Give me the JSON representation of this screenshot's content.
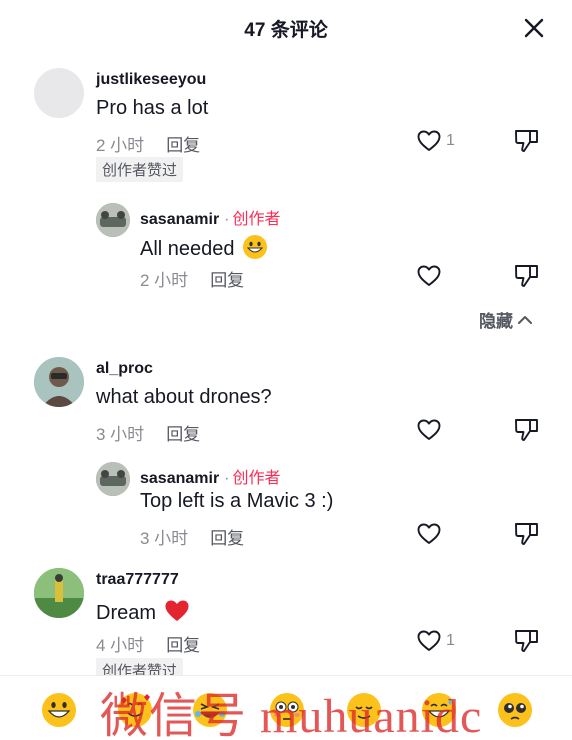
{
  "header": {
    "title": "47 条评论",
    "close_icon": "close-icon"
  },
  "comments": [
    {
      "username": "justlikeseeyou",
      "text": "Pro has a lot",
      "time": "2 小时",
      "reply_label": "回复",
      "like_count": "1",
      "badge": "创作者赞过",
      "avatar_color": "#e8e8ea"
    },
    {
      "username": "al_proc",
      "text": "what about drones?",
      "time": "3 小时",
      "reply_label": "回复",
      "avatar_color": "#9fb8b4"
    },
    {
      "username": "traa777777",
      "text": "Dream",
      "text_emoji": "red-heart",
      "time": "4 小时",
      "reply_label": "回复",
      "like_count": "1",
      "badge": "创作者赞过",
      "avatar_color": "#6fa06a"
    }
  ],
  "replies": [
    {
      "username": "sasanamir",
      "dot": "·",
      "creator_label": "创作者",
      "text": "All needed",
      "text_emoji": "grinning-face",
      "time": "2 小时",
      "reply_label": "回复",
      "avatar_color": "#8a8f8a"
    },
    {
      "username": "sasanamir",
      "dot": "·",
      "creator_label": "创作者",
      "text": "Top left is a Mavic 3 :)",
      "time": "3 小时",
      "reply_label": "回复",
      "avatar_color": "#8a8f8a"
    }
  ],
  "hide_replies": {
    "label": "隐藏",
    "icon": "chevron-up-icon"
  },
  "emoji_bar": [
    "grinning-face",
    "smiling-face-with-hearts",
    "rolling-laughing-face",
    "flushed-face",
    "relieved-face",
    "sweat-smile-face",
    "pleading-face"
  ],
  "watermark": "微信号 muhuanidc",
  "colors": {
    "accent": "#fe2c55",
    "muted": "#8a8b91",
    "text": "#161823",
    "badge_bg": "#f1f1f2"
  }
}
